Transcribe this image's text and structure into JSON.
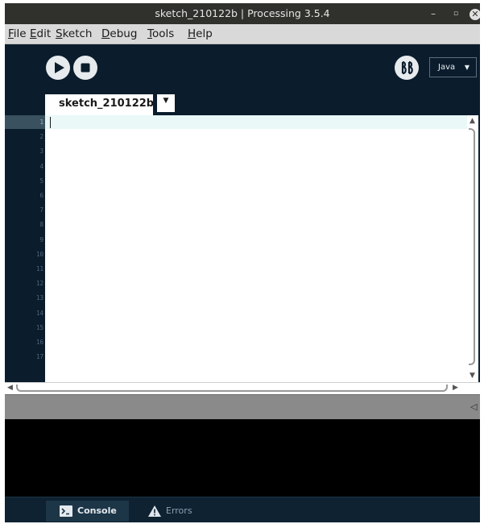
{
  "window": {
    "title": "sketch_210122b | Processing 3.5.4",
    "controls": {
      "minimize": "–",
      "maximize": "▫",
      "close": "✕"
    }
  },
  "menu": [
    {
      "mnemonic": "F",
      "rest": "ile"
    },
    {
      "mnemonic": "E",
      "rest": "dit"
    },
    {
      "mnemonic": "S",
      "rest": "ketch"
    },
    {
      "mnemonic": "D",
      "rest": "ebug"
    },
    {
      "mnemonic": "T",
      "rest": "ools"
    },
    {
      "mnemonic": "H",
      "rest": "elp"
    }
  ],
  "toolbar": {
    "run_icon": "play-icon",
    "stop_icon": "stop-icon",
    "debugger_icon": "debugger-icon",
    "mode": "Java",
    "mode_caret": "▼"
  },
  "tabs": {
    "active": "sketch_210122b",
    "menu_caret": "▼"
  },
  "editor": {
    "line_numbers": [
      "1",
      "2",
      "3",
      "4",
      "5",
      "6",
      "7",
      "8",
      "9",
      "10",
      "11",
      "12",
      "13",
      "14",
      "15",
      "16",
      "17"
    ],
    "current_line": 1,
    "content": ""
  },
  "status": {
    "collapse_icon": "◁"
  },
  "footer": {
    "console_label": "Console",
    "errors_label": "Errors"
  },
  "colors": {
    "background": "#0b1d2c",
    "editor_bg": "#ffffff",
    "current_line_bg": "#eaf8f8",
    "menubar_bg": "#d9d9d9",
    "console_bg": "#000000",
    "statusbar_bg": "#8a8a8a"
  }
}
